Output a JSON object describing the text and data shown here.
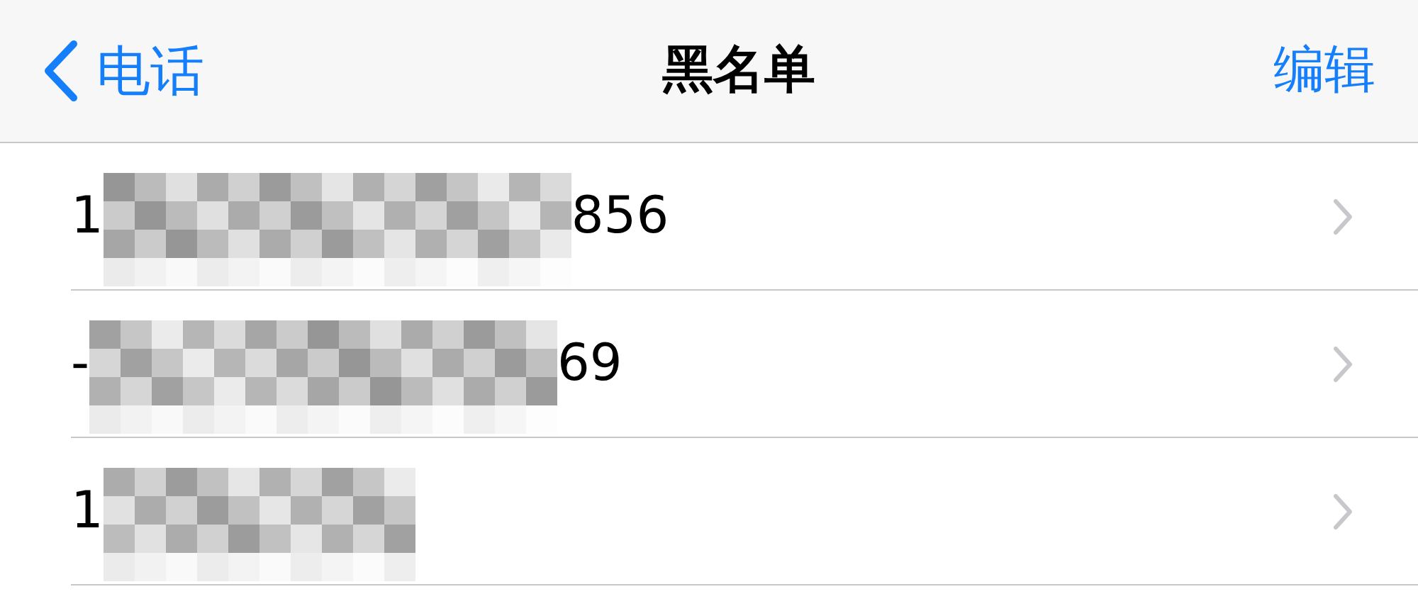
{
  "nav": {
    "back": "电话",
    "title": "黑名单",
    "action": "编辑"
  },
  "rows": [
    {
      "prefix": "1",
      "suffix": "856"
    },
    {
      "prefix": "-",
      "suffix": "69"
    },
    {
      "prefix": "1"
    }
  ]
}
